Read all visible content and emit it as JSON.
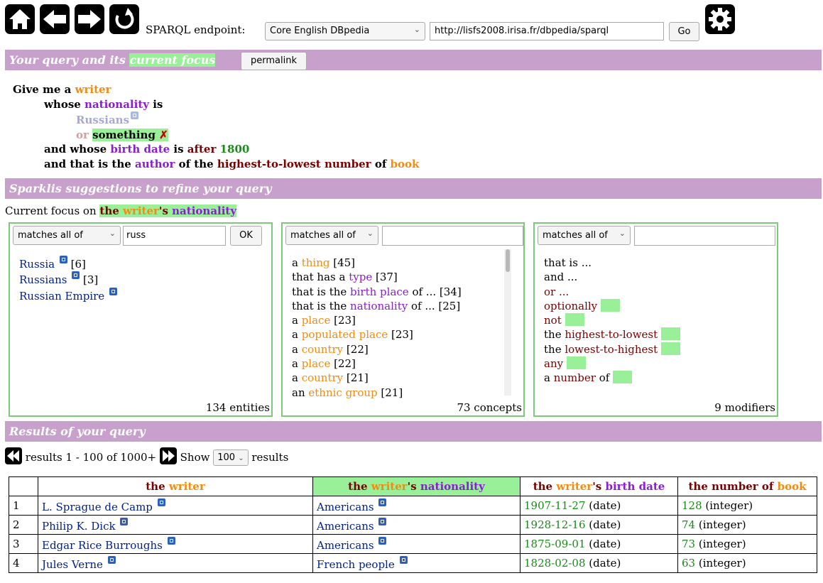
{
  "toolbar": {
    "endpoint_label": "SPARQL endpoint:",
    "endpoint_selected": "Core English DBpedia",
    "endpoint_url": "http://lisfs2008.irisa.fr/dbpedia/sparql",
    "go_label": "Go",
    "icons": [
      "home-icon",
      "back-arrow-icon",
      "forward-arrow-icon",
      "refresh-icon",
      "gear-icon"
    ]
  },
  "query_section": {
    "title_part1": "Your query and its ",
    "title_highlight": "current focus",
    "permalink_label": "permalink"
  },
  "query": {
    "l1_a": "Give me a ",
    "l1_writer": "writer",
    "l2_whose": "whose ",
    "l2_nationality": "nationality",
    "l2_is": " is",
    "l3_russians": "Russians",
    "l4_or": "or ",
    "l4_something": "something",
    "l4_delete": "✗",
    "l5_a": "and whose ",
    "l5_birth": "birth date",
    "l5_is": " is ",
    "l5_after": "after",
    "l5_year": "1800",
    "l6_a": "and that is the ",
    "l6_author": "author",
    "l6_of": " of the ",
    "l6_order": "highest-to-lowest number",
    "l6_of2": " of ",
    "l6_book": "book"
  },
  "suggest_section": {
    "title": "Sparklis suggestions to refine your query",
    "focus_prefix": "Current focus on ",
    "focus_the": "the ",
    "focus_writer": "writer",
    "focus_s": "'s ",
    "focus_nationality": "nationality"
  },
  "entities_box": {
    "match_mode": "matches all of",
    "filter_value": "russ",
    "ok_label": "OK",
    "items": [
      {
        "label": "Russia",
        "count": " [6]"
      },
      {
        "label": "Russians",
        "count": " [3]"
      },
      {
        "label": "Russian Empire",
        "count": ""
      }
    ],
    "count_label": "134 entities"
  },
  "concepts_box": {
    "match_mode": "matches all of",
    "filter_value": "",
    "items": [
      {
        "pre": "a ",
        "hl": "thing",
        "post": " [45]",
        "hl_color": "orange"
      },
      {
        "pre": "that has a ",
        "hl": "type",
        "post": " [37]",
        "hl_color": "purple"
      },
      {
        "pre": "that is the ",
        "hl": "birth place",
        "post": " of ... [34]",
        "hl_color": "purple"
      },
      {
        "pre": "that is the ",
        "hl": "nationality",
        "post": " of ... [25]",
        "hl_color": "purple"
      },
      {
        "pre": "a ",
        "hl": "place",
        "post": " [23]",
        "hl_color": "orange"
      },
      {
        "pre": "a ",
        "hl": "populated place",
        "post": " [23]",
        "hl_color": "orange"
      },
      {
        "pre": "a ",
        "hl": "country",
        "post": " [22]",
        "hl_color": "orange"
      },
      {
        "pre": "a ",
        "hl": "place",
        "post": " [22]",
        "hl_color": "orange"
      },
      {
        "pre": "a ",
        "hl": "country",
        "post": " [21]",
        "hl_color": "orange"
      },
      {
        "pre": "an ",
        "hl": "ethnic group",
        "post": " [21]",
        "hl_color": "orange"
      }
    ],
    "count_label": "73 concepts"
  },
  "modifiers_box": {
    "match_mode": "matches all of",
    "filter_value": "",
    "items": [
      {
        "pre": "that is ...",
        "hl": "",
        "post": "",
        "square": false
      },
      {
        "pre": "and ...",
        "hl": "",
        "post": "",
        "square": false
      },
      {
        "pre": "",
        "hl": "or ...",
        "post": "",
        "square": false
      },
      {
        "pre": "",
        "hl": "optionally",
        "post": " ",
        "square": true
      },
      {
        "pre": "",
        "hl": "not",
        "post": " ",
        "square": true
      },
      {
        "pre": "the ",
        "hl": "highest-to-lowest",
        "post": " ",
        "square": true
      },
      {
        "pre": "the ",
        "hl": "lowest-to-highest",
        "post": " ",
        "square": true
      },
      {
        "pre": "",
        "hl": "any",
        "post": " ",
        "square": true
      },
      {
        "pre": "a ",
        "hl": "number",
        "post": " of ",
        "square": true
      }
    ],
    "count_label": "9 modifiers"
  },
  "results_section": {
    "title": "Results of your query",
    "range_text": " results 1 - 100 of 1000+ ",
    "show_label": " Show ",
    "page_size": "100",
    "results_label": " results"
  },
  "results_table": {
    "headers": {
      "writer_the": "the ",
      "writer_w": "writer",
      "nat_the": "the ",
      "nat_w": "writer",
      "nat_s": "'s ",
      "nat_n": "nationality",
      "bd_the": "the ",
      "bd_w": "writer",
      "bd_s": "'s ",
      "bd_b": "birth date",
      "num_the": "the number of ",
      "num_b": "book"
    },
    "rows": [
      {
        "n": "1",
        "writer": "L. Sprague de Camp",
        "nationality": "Americans",
        "date": "1907-11-27",
        "date_type": " (date)",
        "books": "128",
        "books_type": " (integer)"
      },
      {
        "n": "2",
        "writer": "Philip K. Dick",
        "nationality": "Americans",
        "date": "1928-12-16",
        "date_type": " (date)",
        "books": "74",
        "books_type": " (integer)"
      },
      {
        "n": "3",
        "writer": "Edgar Rice Burroughs",
        "nationality": "Americans",
        "date": "1875-09-01",
        "date_type": " (date)",
        "books": "73",
        "books_type": " (integer)"
      },
      {
        "n": "4",
        "writer": "Jules Verne",
        "nationality": "French people",
        "date": "1828-02-08",
        "date_type": " (date)",
        "books": "63",
        "books_type": " (integer)"
      }
    ]
  },
  "colors": {
    "header_bg": "#c8a0cc",
    "focus_green": "#99f099",
    "class_orange": "#f28c0f",
    "property_purple": "#8a1dd4",
    "operator_darkred": "#7a0000",
    "value_green": "#1a8a1a",
    "entity_navy": "#001f8c"
  }
}
